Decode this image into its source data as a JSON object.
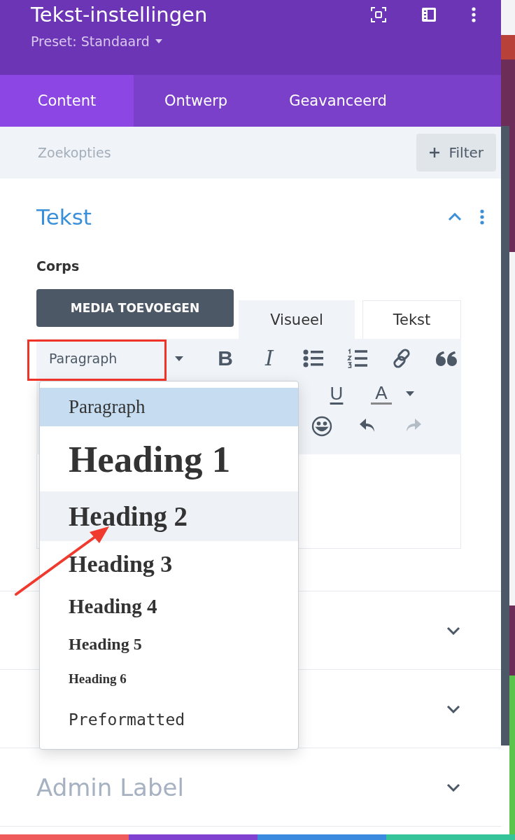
{
  "header": {
    "title": "Tekst-instellingen",
    "preset": "Preset: Standaard"
  },
  "tabs": [
    {
      "label": "Content",
      "selected": true
    },
    {
      "label": "Ontwerp",
      "selected": false
    },
    {
      "label": "Geavanceerd",
      "selected": false
    }
  ],
  "search": {
    "placeholder": "Zoekopties",
    "filter_button": "Filter"
  },
  "section": {
    "title": "Tekst",
    "expanded": true,
    "field_label": "Corps",
    "media_button": "MEDIA TOEVOEGEN",
    "editor_tabs": [
      {
        "label": "Visueel",
        "selected": true
      },
      {
        "label": "Tekst",
        "selected": false
      }
    ],
    "format_select": "Paragraph",
    "toolbar_row_1": [
      {
        "kind": "bold",
        "label": "B"
      },
      {
        "kind": "italic",
        "label": "I"
      },
      {
        "kind": "bullets"
      },
      {
        "kind": "numbers"
      },
      {
        "kind": "link"
      },
      {
        "kind": "quote"
      }
    ],
    "toolbar_row_2": [
      {
        "kind": "underline",
        "label": "U"
      },
      {
        "kind": "color",
        "label": "A"
      }
    ],
    "toolbar_row_3": [
      {
        "kind": "emoji",
        "disabled": false
      },
      {
        "kind": "undo",
        "disabled": false
      },
      {
        "kind": "redo",
        "disabled": true
      }
    ]
  },
  "collapsed_sections": [
    {
      "expanded": false
    },
    {
      "expanded": false
    },
    {
      "title": "Admin Label",
      "expanded": false
    }
  ],
  "format_dropdown": [
    {
      "kind": "paragraph",
      "label": "Paragraph",
      "selected": true,
      "hovered": false
    },
    {
      "kind": "h1",
      "label": "Heading 1",
      "selected": false,
      "hovered": false
    },
    {
      "kind": "h2",
      "label": "Heading 2",
      "selected": false,
      "hovered": true
    },
    {
      "kind": "h3",
      "label": "Heading 3",
      "selected": false,
      "hovered": false
    },
    {
      "kind": "h4",
      "label": "Heading 4",
      "selected": false,
      "hovered": false
    },
    {
      "kind": "h5",
      "label": "Heading 5",
      "selected": false,
      "hovered": false
    },
    {
      "kind": "h6",
      "label": "Heading 6",
      "selected": false,
      "hovered": false
    },
    {
      "kind": "pre",
      "label": "Preformatted",
      "selected": false,
      "hovered": false
    }
  ]
}
